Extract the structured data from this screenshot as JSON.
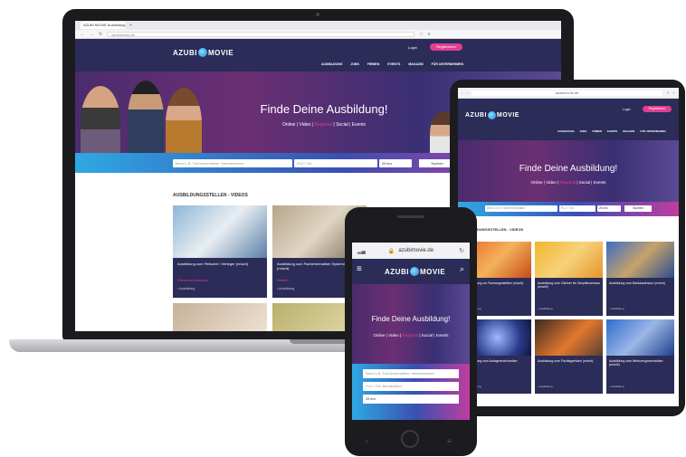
{
  "laptop": {
    "tab_label": "AZUBI MOVIE Ausbildung",
    "url": "azubimovie.de",
    "logo_left": "AZUBI",
    "logo_right": "MOVIE",
    "login": "Login",
    "register": "Registrieren",
    "menu": [
      "AUSBILDUNG",
      "JOBS",
      "FIRMEN",
      "EVENTS",
      "MAGAZIN",
      "FÜR UNTERNEHMEN"
    ],
    "hero_title": "Finde Deine Ausbildung!",
    "hero_sub_1": "Online | Video | ",
    "hero_sub_hl": "Regional",
    "hero_sub_2": " | Social | Events",
    "search_placeholder": "Beruf z.B. Fachinformatiker, Mechatroniker",
    "location_placeholder": "PLZ / Ort",
    "radius": "25 km",
    "search_button": "Suchen",
    "section_title": "AUSBILDUNGSSTELLEN - VIDEOS",
    "cards": [
      {
        "title": "Ausbildung zum Fleischer / Metzger (m/w/d)",
        "tag": "Fleischerhandwerk",
        "meta": "• Ausbildung"
      },
      {
        "title": "Ausbildung zum Fachinformatiker Systemintegration (m/w/d)",
        "tag": "Betrieb",
        "meta": "• Ausbildung"
      }
    ]
  },
  "tablet": {
    "url": "azubimovie.de",
    "logo_left": "AZUBI",
    "logo_right": "MOVIE",
    "login": "Login",
    "register": "Registrieren",
    "menu": [
      "AUSBILDUNG",
      "JOBS",
      "FIRMEN",
      "EVENTS",
      "MAGAZIN",
      "FÜR UNTERNEHMEN"
    ],
    "hero_title": "Finde Deine Ausbildung!",
    "hero_sub_1": "Online | Video | ",
    "hero_sub_hl": "Regional",
    "hero_sub_2": " | Social | Events",
    "search_placeholder": "Beruf z.B. Fachinformatiker",
    "location_placeholder": "PLZ / Ort",
    "radius": "25 km",
    "search_button": "Suchen",
    "section_title": "AUSBILDUNGSSTELLEN - VIDEOS",
    "cards": [
      {
        "title": "Ausbildung zur Fachangestellten (m/w/d)",
        "meta": "• Ausbildung"
      },
      {
        "title": "Ausbildung zum Gärtner für Zierpflanzenbau (m/w/d)",
        "meta": "• Ausbildung"
      },
      {
        "title": "Ausbildung zum Bankkaufmann (m/w/d)",
        "meta": "• Ausbildung"
      },
      {
        "title": "Ausbildung zum Anlagenmechaniker (m/w/d)",
        "meta": "• Ausbildung"
      },
      {
        "title": "Ausbildung zum Fachlageristen (m/w/d)",
        "meta": "• Ausbildung"
      },
      {
        "title": "Ausbildung zum Werkzeugmechaniker (m/w/d)",
        "meta": "• Ausbildung"
      }
    ]
  },
  "phone": {
    "url": "azubimovie.de",
    "logo_left": "AZUBI",
    "logo_right": "MOVIE",
    "hero_title": "Finde Deine Ausbildung!",
    "hero_sub_1": "Online | Video | ",
    "hero_sub_hl": "Regional",
    "hero_sub_2": " | Social | Events",
    "search_placeholder": "Beruf z.B. Fachinformatiker, Mechatroniker",
    "location_placeholder": "PLZ / Ort, Bundesland",
    "radius": "25 km"
  }
}
